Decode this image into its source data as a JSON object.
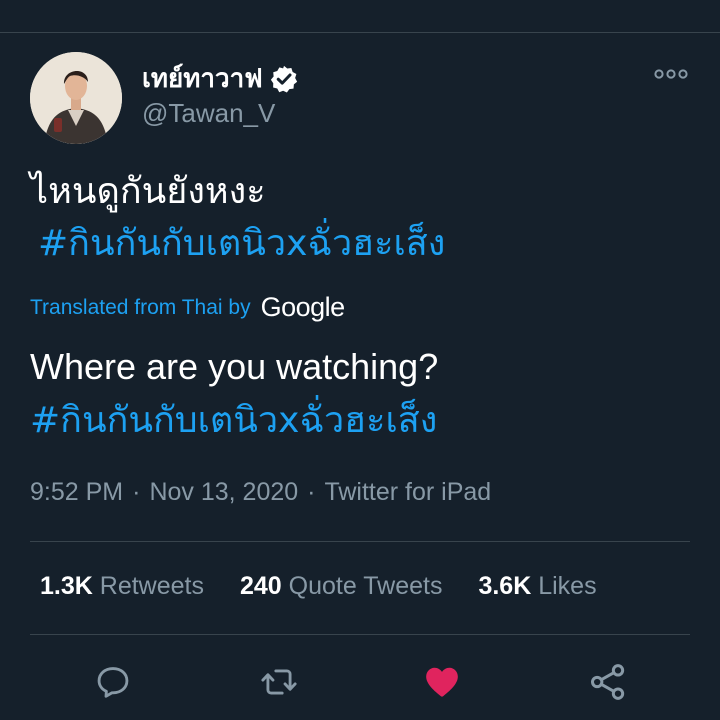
{
  "tweet": {
    "display_name": "เทย์ทาวาฟ",
    "handle": "@Tawan_V",
    "text_line_1": "ไหนดูกันยังหงะ",
    "hashtag": "#กินกันกับเตนิวxฉั่วฮะเส็ง",
    "translated_label": "Translated from Thai by",
    "translation_provider": "Google",
    "translation_text": "Where are you watching?",
    "translation_hashtag": "#กินกันกับเตนิวxฉั่วฮะเส็ง",
    "time": "9:52 PM",
    "date": "Nov 13, 2020",
    "meta_separator": "·",
    "source": "Twitter for iPad"
  },
  "stats": {
    "retweets_count": "1.3K",
    "retweets_label": "Retweets",
    "quotes_count": "240",
    "quotes_label": "Quote Tweets",
    "likes_count": "3.6K",
    "likes_label": "Likes"
  },
  "actions": {
    "reply_icon": "reply-icon",
    "retweet_icon": "retweet-icon",
    "like_icon": "heart-icon",
    "share_icon": "share-icon",
    "liked": true
  },
  "colors": {
    "background": "#15202b",
    "accent": "#1da1f2",
    "secondary_text": "#8899a6",
    "like": "#e0245e",
    "divider": "#38444d"
  }
}
